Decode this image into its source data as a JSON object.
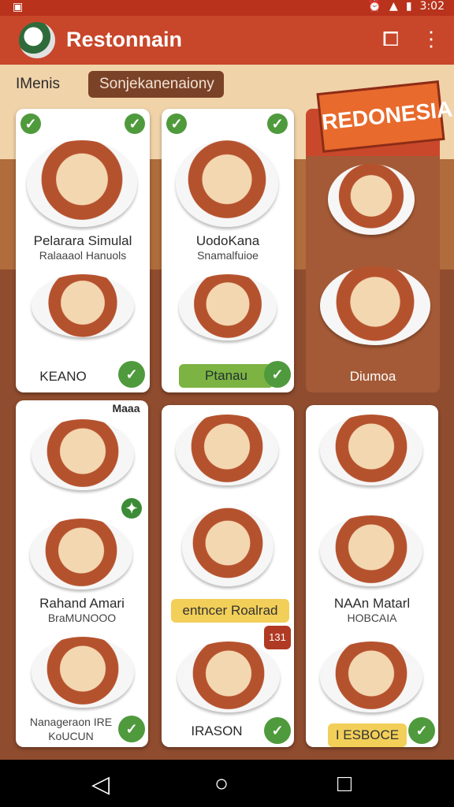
{
  "status": {
    "left_icon": "notification-icon",
    "right_time": "3:02"
  },
  "appbar": {
    "title": "Restonnain"
  },
  "filters": {
    "menus": "IMenis",
    "search_placeholder": "Sonjekanenaiony"
  },
  "banner": {
    "text": "REDONESIA"
  },
  "cards": [
    {
      "label": "Pelarara Simulal",
      "sub": "Ralaaaol Hanuols",
      "tag": "KEANO"
    },
    {
      "label": "UodoKana",
      "sub": "Snamalfuioe",
      "tag": "Ptanau"
    },
    {
      "label": "Diumoa"
    },
    {
      "label": "Maaa"
    },
    {
      "label": "Rahand Amari",
      "sub": "BraMUNOOO"
    },
    {
      "label": "entncer Roalrad"
    },
    {
      "label": "NAAn Matarl",
      "sub": "HOBCAIA"
    },
    {
      "label": "Nanageraon IRE",
      "sub": "KoUCUN"
    },
    {
      "label": "IRASON"
    },
    {
      "label": "I ESBOCE"
    }
  ],
  "misc": {
    "badge_number": "131"
  }
}
